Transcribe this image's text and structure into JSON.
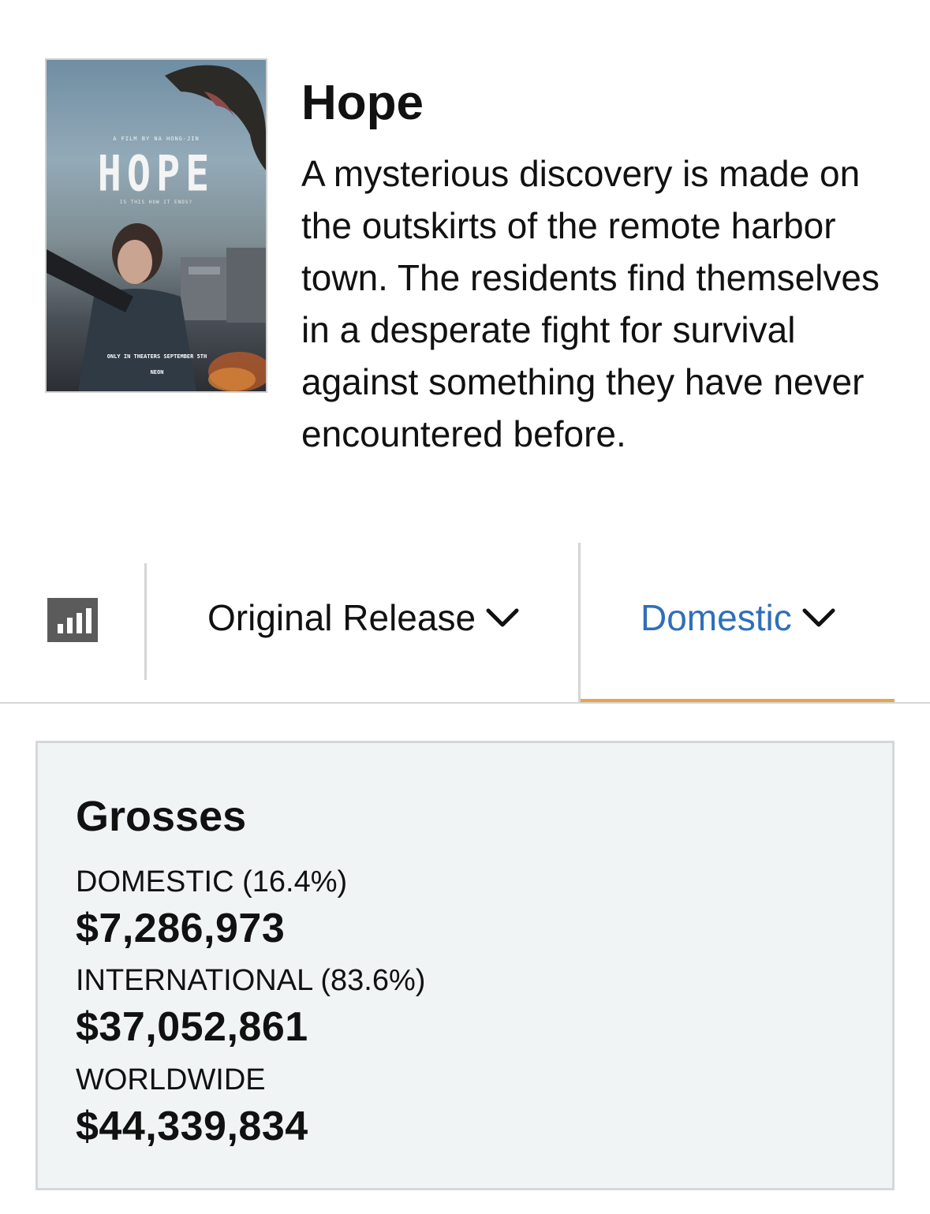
{
  "movie": {
    "title": "Hope",
    "synopsis": "A mysterious discovery is made on the outskirts of the remote harbor town. The residents find themselves in a desperate fight for survival against something they have never encountered before.",
    "poster": {
      "credit": "A FILM BY NA HONG-JIN",
      "logo": "HOPE",
      "tagline": "IS THIS HOW IT ENDS?",
      "release": "ONLY IN THEATERS SEPTEMBER 5TH",
      "distributor": "NEON"
    }
  },
  "tabs": {
    "chart_icon": "bar-chart-icon",
    "release_label": "Original Release",
    "region_label": "Domestic",
    "active_underline_color": "#e8a44a",
    "active_text_color": "#2f6fb8"
  },
  "grosses": {
    "heading": "Grosses",
    "domestic_label": "DOMESTIC (16.4%)",
    "domestic_value": "$7,286,973",
    "international_label": "INTERNATIONAL (83.6%)",
    "international_value": "$37,052,861",
    "worldwide_label": "WORLDWIDE",
    "worldwide_value": "$44,339,834"
  }
}
